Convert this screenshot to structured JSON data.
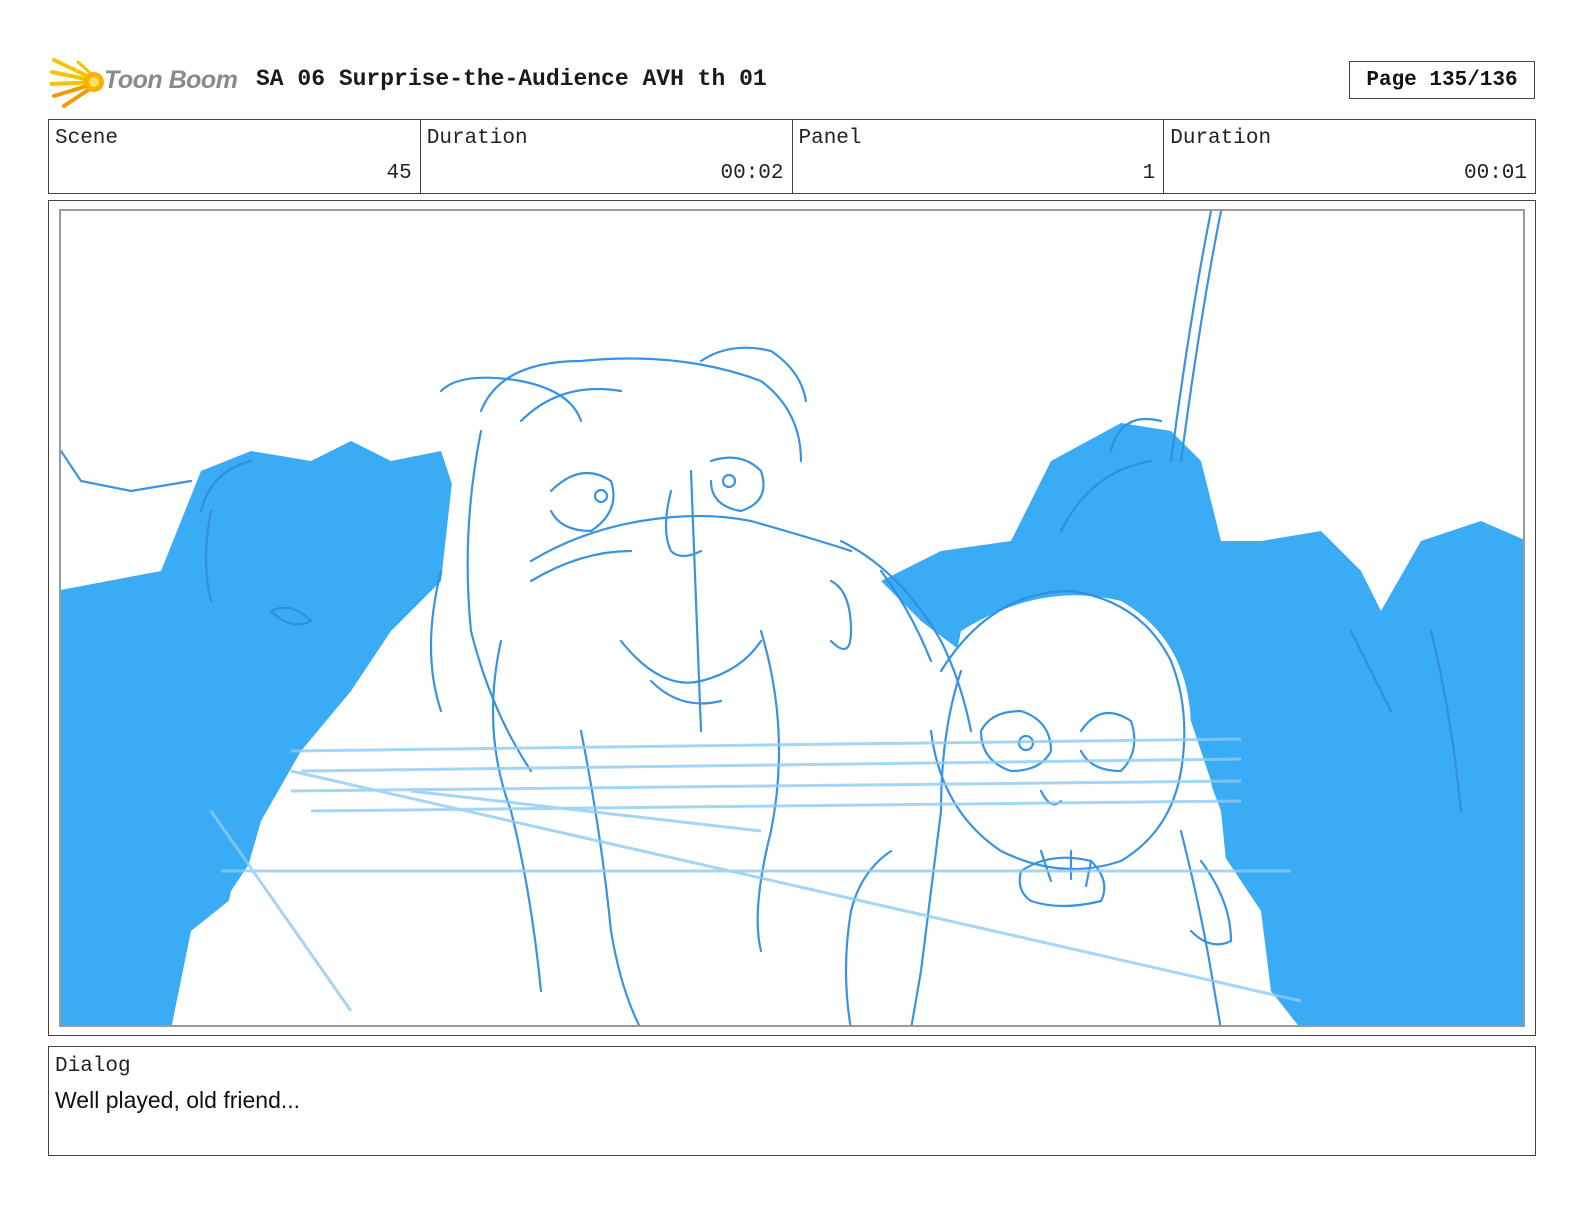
{
  "header": {
    "brand": "Toon Boom",
    "title": "SA 06 Surprise-the-Audience AVH th 01",
    "page": "Page 135/136"
  },
  "info": [
    {
      "label": "Scene",
      "value": "45"
    },
    {
      "label": "Duration",
      "value": "00:02"
    },
    {
      "label": "Panel",
      "value": "1"
    },
    {
      "label": "Duration",
      "value": "00:01"
    }
  ],
  "dialog": {
    "label": "Dialog",
    "text": "Well played, old friend..."
  },
  "colors": {
    "sketch_fill": "#3aabf5",
    "sketch_line": "#2f8ee0",
    "logo_yellow": "#f5c400",
    "logo_orange": "#f39a00"
  },
  "icons": {
    "logo": "toon-boom-starburst-icon"
  }
}
